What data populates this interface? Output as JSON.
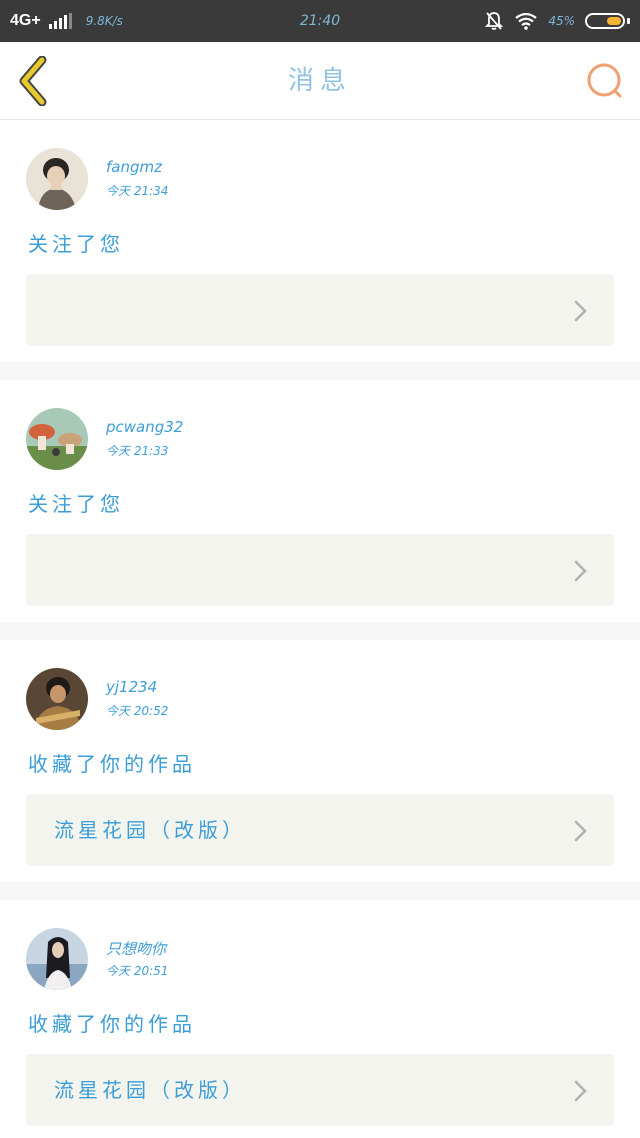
{
  "status_bar": {
    "network": "4G+",
    "speed": "9.8K/s",
    "time": "21:40",
    "battery": "45%",
    "battery_level": 0.45
  },
  "nav": {
    "title": "消息",
    "back_icon": "chevron-left-icon",
    "search_icon": "search-icon",
    "accent_back": "#e0c020",
    "accent_search": "#f0a070"
  },
  "colors": {
    "text_blue": "#3c9ed8",
    "title_blue": "#8fc3e6",
    "box_bg": "#f4f4ef"
  },
  "messages": [
    {
      "username": "fangmz",
      "time": "今天 21:34",
      "action": "关注了您",
      "work_title": ""
    },
    {
      "username": "pcwang32",
      "time": "今天 21:33",
      "action": "关注了您",
      "work_title": ""
    },
    {
      "username": "yj1234",
      "time": "今天 20:52",
      "action": "收藏了你的作品",
      "work_title": "流星花园（改版）"
    },
    {
      "username": "只想吻你",
      "time": "今天 20:51",
      "action": "收藏了你的作品",
      "work_title": "流星花园（改版）"
    }
  ]
}
